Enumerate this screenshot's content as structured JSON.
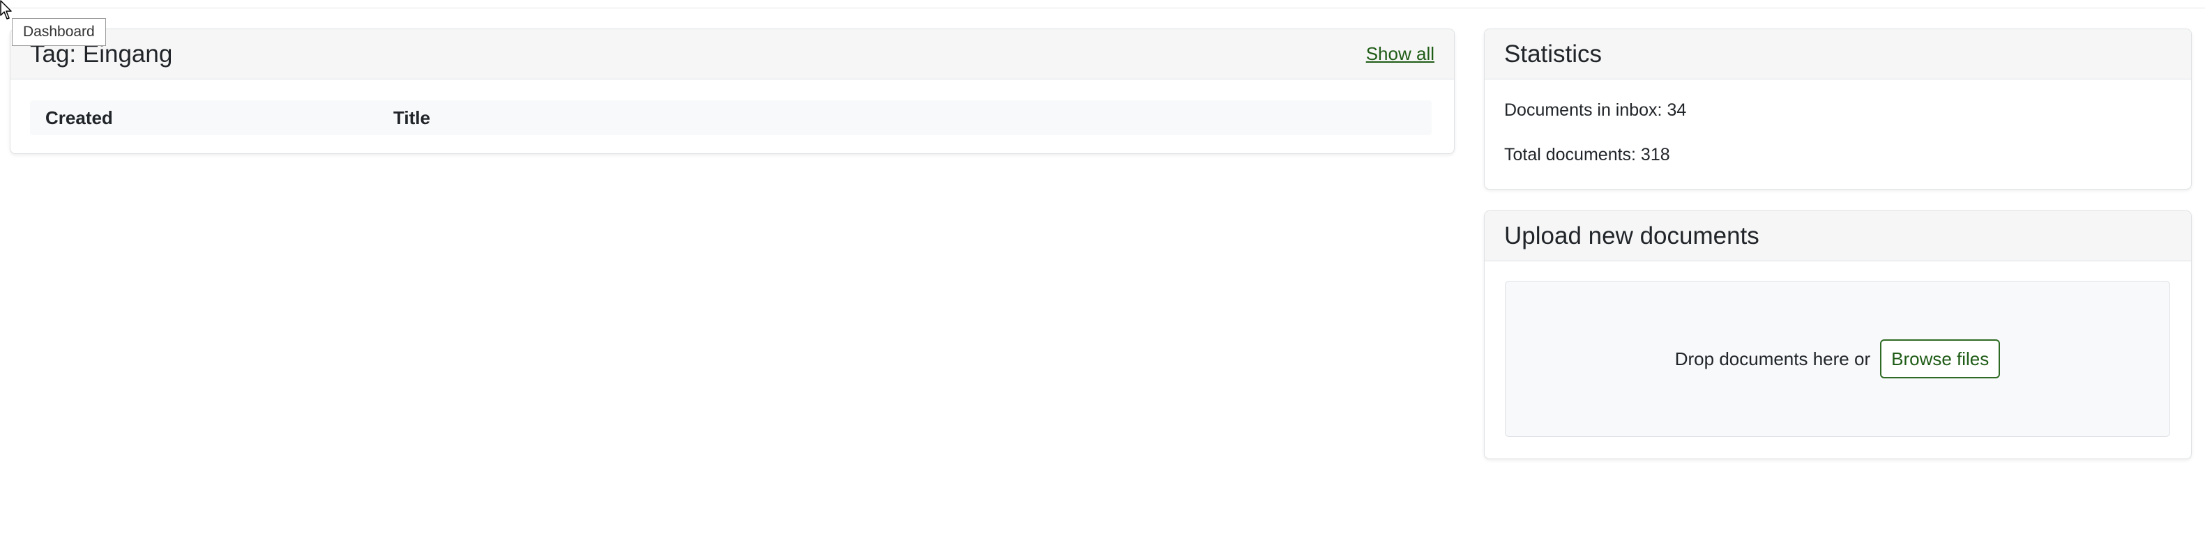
{
  "tooltip": {
    "text": "Dashboard"
  },
  "tag_widget": {
    "title": "Tag: Eingang",
    "show_all": "Show all",
    "columns": [
      "Created",
      "Title"
    ],
    "rows": []
  },
  "statistics": {
    "title": "Statistics",
    "inbox_text": "Documents in inbox: 34",
    "total_text": "Total documents: 318"
  },
  "upload": {
    "title": "Upload new documents",
    "drop_text": "Drop documents here or",
    "browse_label": "Browse files"
  },
  "colors": {
    "accent": "#1f5c16",
    "header_bg": "#f6f6f6",
    "border": "#dfe1e4"
  },
  "icons": {
    "cursor": "mouse-pointer-icon"
  }
}
